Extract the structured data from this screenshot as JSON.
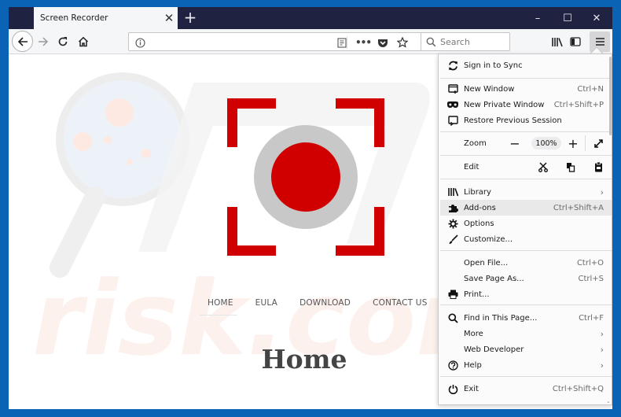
{
  "browser": {
    "tab_title": "Screen Recorder",
    "new_tab_icon": "plus-icon",
    "window_controls": {
      "minimize": "–",
      "maximize": "☐",
      "close": "✕"
    },
    "search_placeholder": "Search",
    "address_value": ""
  },
  "site": {
    "nav": [
      {
        "label": "HOME"
      },
      {
        "label": "EULA"
      },
      {
        "label": "DOWNLOAD"
      },
      {
        "label": "CONTACT US"
      }
    ],
    "heading": "Home",
    "logo_colors": {
      "red": "#d10000",
      "ring": "#c8c8c8"
    }
  },
  "menu": {
    "sign_in": "Sign in to Sync",
    "new_window": {
      "label": "New Window",
      "shortcut": "Ctrl+N"
    },
    "new_private_window": {
      "label": "New Private Window",
      "shortcut": "Ctrl+Shift+P"
    },
    "restore_session": {
      "label": "Restore Previous Session"
    },
    "zoom": {
      "label": "Zoom",
      "value": "100%"
    },
    "edit": {
      "label": "Edit"
    },
    "library": {
      "label": "Library"
    },
    "addons": {
      "label": "Add-ons",
      "shortcut": "Ctrl+Shift+A"
    },
    "options": {
      "label": "Options"
    },
    "customize": {
      "label": "Customize..."
    },
    "open_file": {
      "label": "Open File...",
      "shortcut": "Ctrl+O"
    },
    "save_page": {
      "label": "Save Page As...",
      "shortcut": "Ctrl+S"
    },
    "print": {
      "label": "Print..."
    },
    "find": {
      "label": "Find in This Page...",
      "shortcut": "Ctrl+F"
    },
    "more": {
      "label": "More"
    },
    "web_developer": {
      "label": "Web Developer"
    },
    "help": {
      "label": "Help"
    },
    "exit": {
      "label": "Exit",
      "shortcut": "Ctrl+Shift+Q"
    }
  },
  "colors": {
    "desktop": "#0a63b4",
    "tabstrip": "#1f2240",
    "accent_red": "#d10000"
  }
}
